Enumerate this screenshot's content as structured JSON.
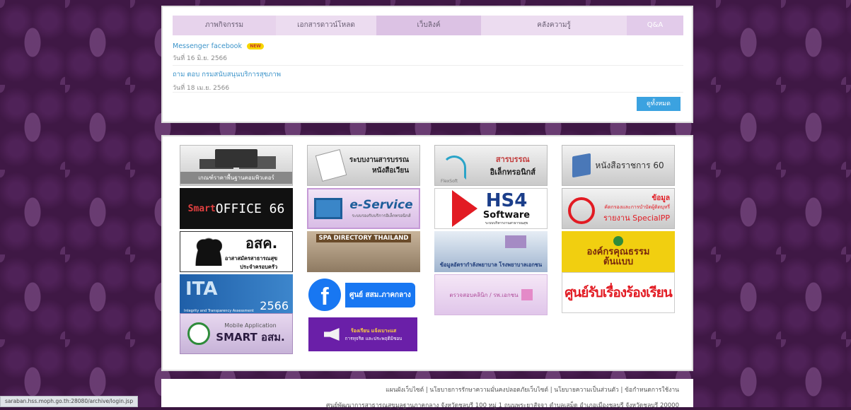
{
  "tabs": [
    "ภาพกิจกรรม",
    "เอกสารดาวน์โหลด",
    "เว็บลิงค์",
    "คลังความรู้",
    "Q&A"
  ],
  "news": [
    {
      "title": "Messenger facebook",
      "badge": "NEW",
      "date": "วันที่ 16 มิ.ย. 2566"
    },
    {
      "title": "ถาม ตอบ กรมสนับสนุนบริการสุขภาพ",
      "date": "วันที่ 18 เม.ย. 2566"
    }
  ],
  "view_all": "ดูทั้งหมด",
  "banners": {
    "b1": "เกณฑ์ราคาพื้นฐานคอมพิวเตอร์",
    "b2a": "ระบบงานสารบรรณ",
    "b2b": "หนังสือเวียน",
    "b3a": "สารบรรณ",
    "b3b": "อิเล็กทรอนิกส์",
    "b3c": "FlexSoft",
    "b4": "หนังสือราชการ 60",
    "b5": "OFFICE 66",
    "b5s": "Smart",
    "b6": "e-Service",
    "b6s": "ระบบรองรับบริการอิเล็กทรอนิกส์",
    "b7a": "HS4",
    "b7b": "Software",
    "b7c": "ระบบบริหารงานสาธารณสุข",
    "b8a": "ข้อมูล",
    "b8b": "คัดกรองและการบำบัดผู้ติดบุหรี่",
    "b8c": "รายงาน SpecialPP",
    "b9a": "อสค.",
    "b9b": "อาสาสมัครสาธารณสุข",
    "b9c": "ประจำครอบครัว",
    "b10": "SPA DIRECTORY THAILAND",
    "b11": "ข้อมูลอัตรากำลังพยาบาล โรงพยาบาลเอกชน",
    "b12": "องค์กรคุณธรรมต้นแบบ",
    "b13": "2566",
    "b13s": "Integrity and Transparency Assessment",
    "b14": "ศูนย์ สสม.ภาคกลาง",
    "b15": "ตรวจสอบคลินิก / รพ.เอกชน",
    "b16": "ศูนย์รับเรื่องร้องเรียน",
    "b17a": "Mobile Application",
    "b17b": "SMART อสม.",
    "b18a": "ร้องเรียน แจ้งเบาะแส",
    "b18b": "การทุจริต และประพฤติมิชอบ"
  },
  "footer": {
    "links": "แผนผังเว็บไซต์ | นโยบายการรักษาความมั่นคงปลอดภัยเว็บไซต์ | นโยบายความเป็นส่วนตัว | ข้อกำหนดการใช้งาน",
    "address": "ศูนย์พัฒนาการสาธารณสุขมูลฐานภาคกลาง จังหวัดชลบุรี 100 หมู่ 1 ถนนพระยาสัจจา ตำบลเสม็ด อำเภอเมืองชลบุรี จังหวัดชลบุรี 20000"
  },
  "status_url": "saraban.hss.moph.go.th:28080/archive/login.jsp"
}
